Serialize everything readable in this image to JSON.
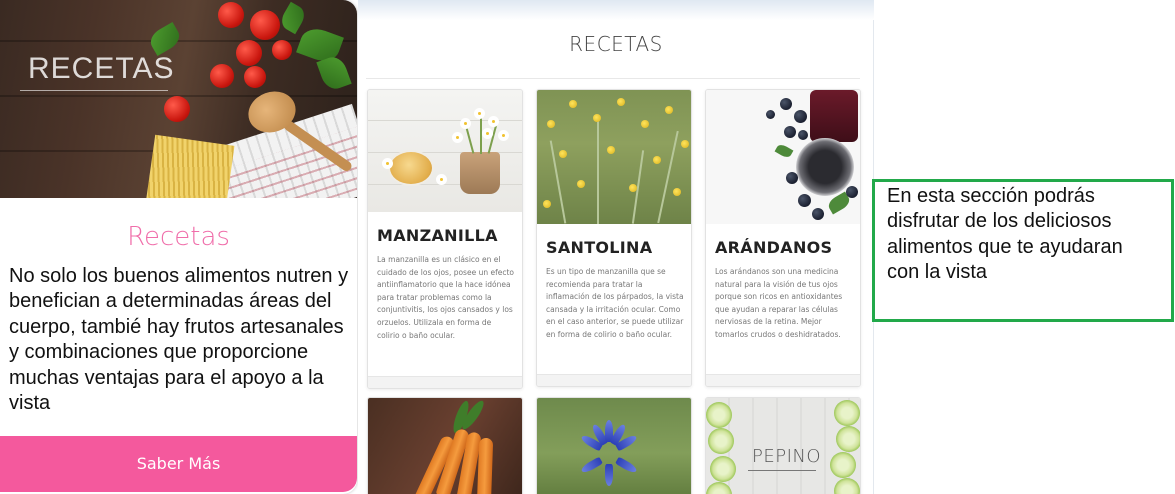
{
  "left_card": {
    "hero_title": "RECETAS",
    "heading": "Recetas",
    "body": "No solo los buenos alimentos nutren y benefician a determinadas áreas del cuerpo, tambié hay frutos artesanales y combinaciones que proporcione muchas ventajas para el apoyo a la vista",
    "button_label": "Saber Más"
  },
  "recipes_section": {
    "title": "RECETAS",
    "cards": [
      {
        "title": "MANZANILLA",
        "text": "La manzanilla es un clásico en el cuidado de los ojos, posee un efecto antiinflamatorio que la hace idónea para tratar problemas como la conjuntivitis, los ojos cansados y los orzuelos. Utilizala en forma de colirio o baño ocular."
      },
      {
        "title": "SANTOLINA",
        "text": "Es un tipo de manzanilla que se recomienda para tratar la inflamación de los párpados, la vista cansada y la irritación ocular. Como en el caso anterior, se puede utilizar en forma de colirio o baño ocular."
      },
      {
        "title": "ARÁNDANOS",
        "text": "Los arándanos son una medicina natural para la visión de tus ojos porque son ricos en antioxidantes que ayudan a reparar las células nerviosas de la retina. Mejor tomarlos crudos o deshidratados."
      }
    ],
    "partial_cards": {
      "pepino_label": "PEPINO"
    }
  },
  "note": {
    "text": "En esta sección podrás disfrutar de los deliciosos alimentos que te ayudaran con la vista"
  },
  "colors": {
    "accent_pink": "#f4599d",
    "heading_pink": "#f06eaa",
    "note_border": "#22a94a"
  }
}
